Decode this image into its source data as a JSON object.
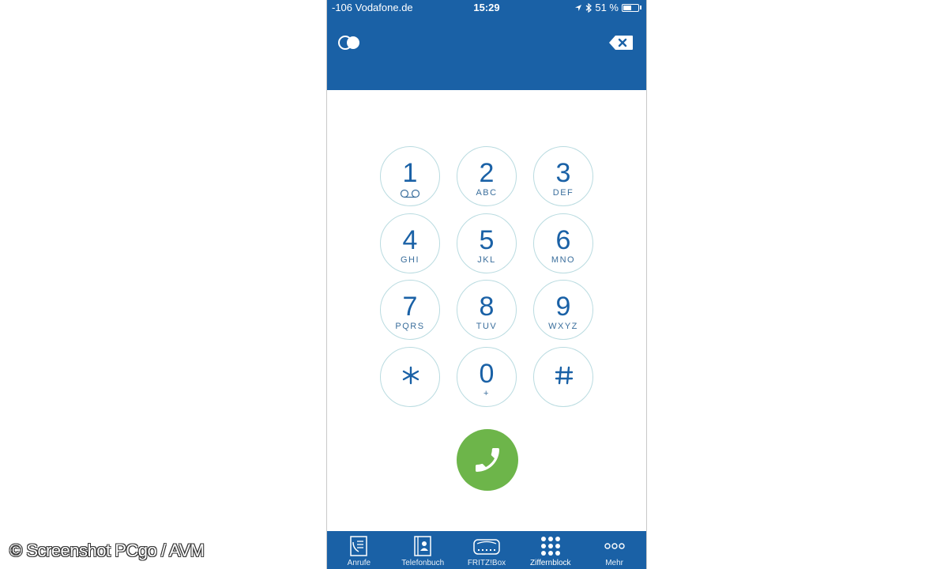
{
  "status_bar": {
    "carrier": "-106 Vodafone.de",
    "time": "15:29",
    "battery": "51 %"
  },
  "header": {
    "toggle_icon": "toggle-circles-icon",
    "delete_icon": "backspace-icon"
  },
  "keypad": {
    "keys": [
      {
        "digit": "1",
        "letters": ""
      },
      {
        "digit": "2",
        "letters": "ABC"
      },
      {
        "digit": "3",
        "letters": "DEF"
      },
      {
        "digit": "4",
        "letters": "GHI"
      },
      {
        "digit": "5",
        "letters": "JKL"
      },
      {
        "digit": "6",
        "letters": "MNO"
      },
      {
        "digit": "7",
        "letters": "PQRS"
      },
      {
        "digit": "8",
        "letters": "TUV"
      },
      {
        "digit": "9",
        "letters": "WXYZ"
      },
      {
        "digit": "0",
        "letters": "+"
      }
    ],
    "star_icon": "asterisk-icon",
    "hash_icon": "hash-icon",
    "voicemail_icon": "voicemail-icon"
  },
  "call_button": {
    "icon": "phone-icon",
    "color": "#6db54a"
  },
  "tabbar": {
    "tabs": [
      {
        "label": "Anrufe",
        "icon": "call-list-icon"
      },
      {
        "label": "Telefonbuch",
        "icon": "contacts-book-icon"
      },
      {
        "label": "FRITZ!Box",
        "icon": "router-icon"
      },
      {
        "label": "Ziffernblock",
        "icon": "keypad-grid-icon"
      },
      {
        "label": "Mehr",
        "icon": "more-dots-icon"
      }
    ],
    "active_label": "Ziffernblock"
  },
  "colors": {
    "accent": "#1a61a6",
    "key_border": "#b9dbe0",
    "call": "#6db54a"
  },
  "watermark": "© Screenshot PCgo / AVM"
}
